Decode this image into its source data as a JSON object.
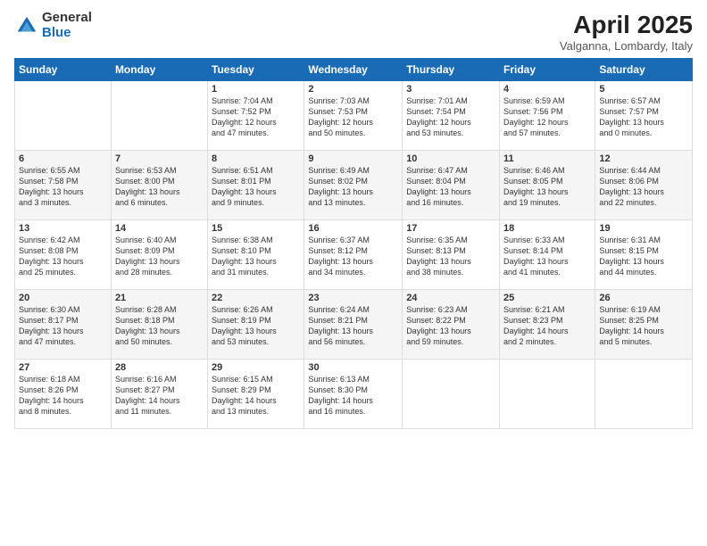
{
  "logo": {
    "general": "General",
    "blue": "Blue"
  },
  "header": {
    "month_year": "April 2025",
    "location": "Valganna, Lombardy, Italy"
  },
  "weekdays": [
    "Sunday",
    "Monday",
    "Tuesday",
    "Wednesday",
    "Thursday",
    "Friday",
    "Saturday"
  ],
  "rows": [
    [
      {
        "day": "",
        "info": ""
      },
      {
        "day": "",
        "info": ""
      },
      {
        "day": "1",
        "info": "Sunrise: 7:04 AM\nSunset: 7:52 PM\nDaylight: 12 hours\nand 47 minutes."
      },
      {
        "day": "2",
        "info": "Sunrise: 7:03 AM\nSunset: 7:53 PM\nDaylight: 12 hours\nand 50 minutes."
      },
      {
        "day": "3",
        "info": "Sunrise: 7:01 AM\nSunset: 7:54 PM\nDaylight: 12 hours\nand 53 minutes."
      },
      {
        "day": "4",
        "info": "Sunrise: 6:59 AM\nSunset: 7:56 PM\nDaylight: 12 hours\nand 57 minutes."
      },
      {
        "day": "5",
        "info": "Sunrise: 6:57 AM\nSunset: 7:57 PM\nDaylight: 13 hours\nand 0 minutes."
      }
    ],
    [
      {
        "day": "6",
        "info": "Sunrise: 6:55 AM\nSunset: 7:58 PM\nDaylight: 13 hours\nand 3 minutes."
      },
      {
        "day": "7",
        "info": "Sunrise: 6:53 AM\nSunset: 8:00 PM\nDaylight: 13 hours\nand 6 minutes."
      },
      {
        "day": "8",
        "info": "Sunrise: 6:51 AM\nSunset: 8:01 PM\nDaylight: 13 hours\nand 9 minutes."
      },
      {
        "day": "9",
        "info": "Sunrise: 6:49 AM\nSunset: 8:02 PM\nDaylight: 13 hours\nand 13 minutes."
      },
      {
        "day": "10",
        "info": "Sunrise: 6:47 AM\nSunset: 8:04 PM\nDaylight: 13 hours\nand 16 minutes."
      },
      {
        "day": "11",
        "info": "Sunrise: 6:46 AM\nSunset: 8:05 PM\nDaylight: 13 hours\nand 19 minutes."
      },
      {
        "day": "12",
        "info": "Sunrise: 6:44 AM\nSunset: 8:06 PM\nDaylight: 13 hours\nand 22 minutes."
      }
    ],
    [
      {
        "day": "13",
        "info": "Sunrise: 6:42 AM\nSunset: 8:08 PM\nDaylight: 13 hours\nand 25 minutes."
      },
      {
        "day": "14",
        "info": "Sunrise: 6:40 AM\nSunset: 8:09 PM\nDaylight: 13 hours\nand 28 minutes."
      },
      {
        "day": "15",
        "info": "Sunrise: 6:38 AM\nSunset: 8:10 PM\nDaylight: 13 hours\nand 31 minutes."
      },
      {
        "day": "16",
        "info": "Sunrise: 6:37 AM\nSunset: 8:12 PM\nDaylight: 13 hours\nand 34 minutes."
      },
      {
        "day": "17",
        "info": "Sunrise: 6:35 AM\nSunset: 8:13 PM\nDaylight: 13 hours\nand 38 minutes."
      },
      {
        "day": "18",
        "info": "Sunrise: 6:33 AM\nSunset: 8:14 PM\nDaylight: 13 hours\nand 41 minutes."
      },
      {
        "day": "19",
        "info": "Sunrise: 6:31 AM\nSunset: 8:15 PM\nDaylight: 13 hours\nand 44 minutes."
      }
    ],
    [
      {
        "day": "20",
        "info": "Sunrise: 6:30 AM\nSunset: 8:17 PM\nDaylight: 13 hours\nand 47 minutes."
      },
      {
        "day": "21",
        "info": "Sunrise: 6:28 AM\nSunset: 8:18 PM\nDaylight: 13 hours\nand 50 minutes."
      },
      {
        "day": "22",
        "info": "Sunrise: 6:26 AM\nSunset: 8:19 PM\nDaylight: 13 hours\nand 53 minutes."
      },
      {
        "day": "23",
        "info": "Sunrise: 6:24 AM\nSunset: 8:21 PM\nDaylight: 13 hours\nand 56 minutes."
      },
      {
        "day": "24",
        "info": "Sunrise: 6:23 AM\nSunset: 8:22 PM\nDaylight: 13 hours\nand 59 minutes."
      },
      {
        "day": "25",
        "info": "Sunrise: 6:21 AM\nSunset: 8:23 PM\nDaylight: 14 hours\nand 2 minutes."
      },
      {
        "day": "26",
        "info": "Sunrise: 6:19 AM\nSunset: 8:25 PM\nDaylight: 14 hours\nand 5 minutes."
      }
    ],
    [
      {
        "day": "27",
        "info": "Sunrise: 6:18 AM\nSunset: 8:26 PM\nDaylight: 14 hours\nand 8 minutes."
      },
      {
        "day": "28",
        "info": "Sunrise: 6:16 AM\nSunset: 8:27 PM\nDaylight: 14 hours\nand 11 minutes."
      },
      {
        "day": "29",
        "info": "Sunrise: 6:15 AM\nSunset: 8:29 PM\nDaylight: 14 hours\nand 13 minutes."
      },
      {
        "day": "30",
        "info": "Sunrise: 6:13 AM\nSunset: 8:30 PM\nDaylight: 14 hours\nand 16 minutes."
      },
      {
        "day": "",
        "info": ""
      },
      {
        "day": "",
        "info": ""
      },
      {
        "day": "",
        "info": ""
      }
    ]
  ]
}
